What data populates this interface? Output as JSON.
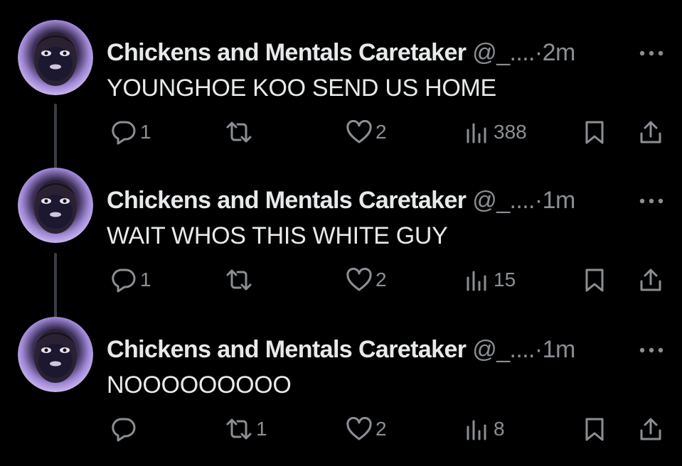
{
  "colors": {
    "background": "#000000",
    "primary_text": "#e7e9ea",
    "secondary_text": "#8b8f94",
    "thread_line": "#3a3d41",
    "avatar_ring": "#b9a3e6"
  },
  "tweets": [
    {
      "display_name": "Chickens and Mentals Caretaker",
      "handle": "@_....",
      "separator": "·",
      "time": "2m",
      "text": "YOUNGHOE KOO SEND US HOME",
      "replies": "1",
      "reposts": "",
      "likes": "2",
      "views": "388"
    },
    {
      "display_name": "Chickens and Mentals Caretaker",
      "handle": "@_....",
      "separator": "·",
      "time": "1m",
      "text": "WAIT WHOS THIS WHITE GUY",
      "replies": "1",
      "reposts": "",
      "likes": "2",
      "views": "15"
    },
    {
      "display_name": "Chickens and Mentals Caretaker",
      "handle": "@_....",
      "separator": "·",
      "time": "1m",
      "text": "NOOOOOOOOO",
      "replies": "",
      "reposts": "1",
      "likes": "2",
      "views": "8"
    }
  ],
  "icons": {
    "reply": "reply-icon",
    "repost": "repost-icon",
    "like": "heart-icon",
    "views": "views-chart-icon",
    "bookmark": "bookmark-icon",
    "share": "share-icon",
    "more": "more-dots-icon"
  }
}
